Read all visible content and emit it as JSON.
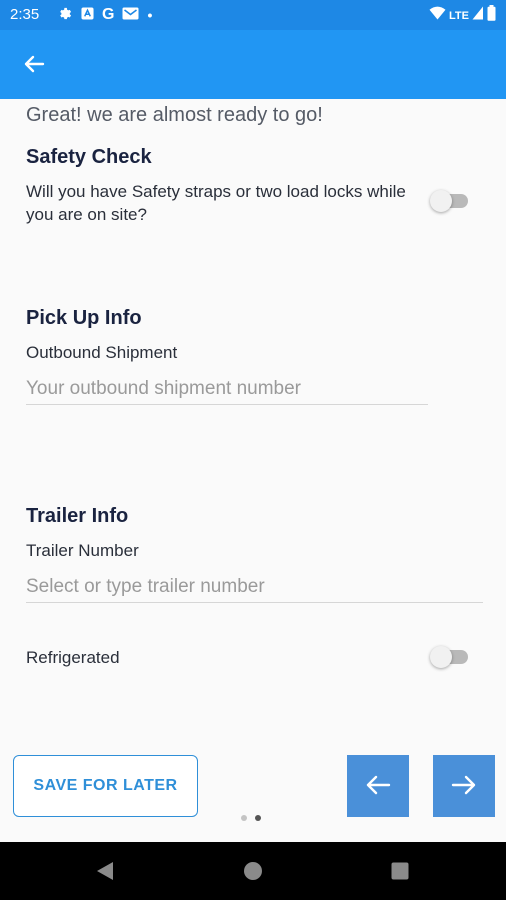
{
  "status_bar": {
    "time": "2:35",
    "network": "LTE"
  },
  "app_bar": {
    "back_icon": "arrow-left-icon"
  },
  "intro": "Great! we are almost ready to go!",
  "safety": {
    "title": "Safety Check",
    "question": "Will you have Safety straps or two load locks while you are on site?",
    "toggle_on": false
  },
  "pickup": {
    "title": "Pick Up Info",
    "label": "Outbound Shipment",
    "value": "",
    "placeholder": "Your outbound shipment number"
  },
  "trailer": {
    "title": "Trailer Info",
    "label": "Trailer Number",
    "value": "",
    "placeholder": "Select or type trailer number",
    "refrigerated_label": "Refrigerated",
    "refrigerated_on": false
  },
  "actions": {
    "save_label": "SAVE FOR LATER",
    "prev_icon": "arrow-left-icon",
    "next_icon": "arrow-right-icon"
  },
  "pager": {
    "total": 2,
    "current": 2
  },
  "colors": {
    "app_bar": "#2196f3",
    "status_bar": "#1e88e5",
    "accent": "#4a90d9",
    "title_text": "#1a2340"
  }
}
